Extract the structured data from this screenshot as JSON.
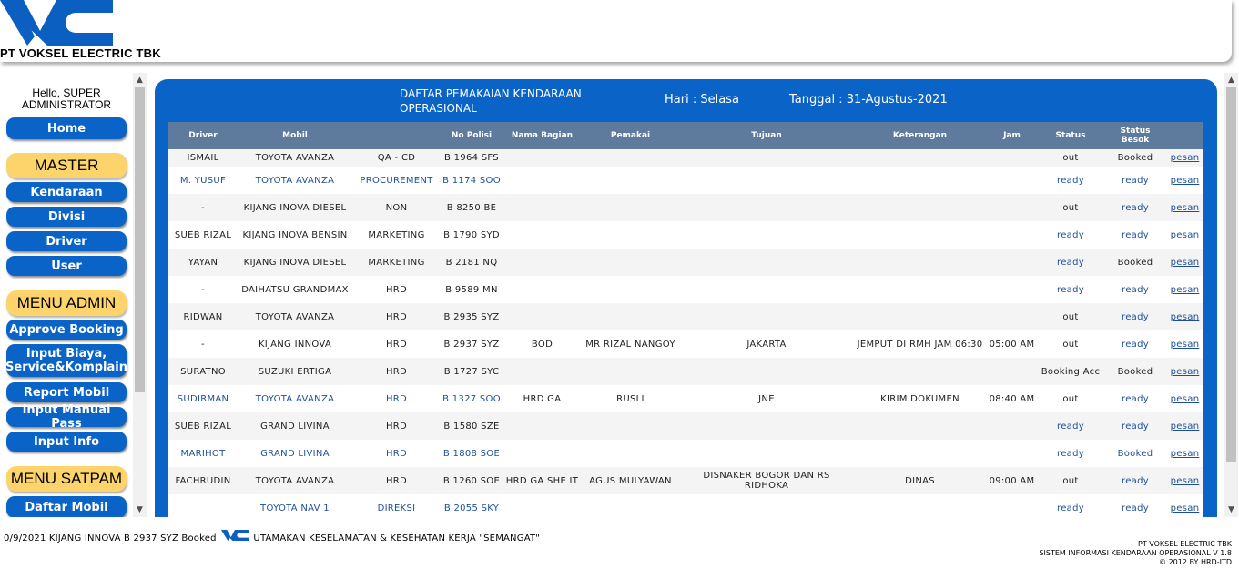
{
  "header": {
    "company": "PT VOKSEL ELECTRIC TBK",
    "logo_icon": "vc-logo-icon",
    "logo_color": "#0a5fc1"
  },
  "sidebar": {
    "greeting": "Hello, SUPER ADMINISTRATOR",
    "home": "Home",
    "master_label": "MASTER",
    "master_items": [
      "Kendaraan",
      "Divisi",
      "Driver",
      "User"
    ],
    "admin_label": "MENU ADMIN",
    "admin_items": [
      "Approve Booking",
      "Input Biaya, Service&Komplain",
      "Report Mobil",
      "Input Manual Pass",
      "Input Info"
    ],
    "satpam_label": "MENU SATPAM",
    "satpam_items": [
      "Daftar Mobil"
    ]
  },
  "panel": {
    "title": "DAFTAR PEMAKAIAN KENDARAAN OPERASIONAL",
    "day": "Hari : Selasa",
    "date": "Tanggal : 31-Agustus-2021",
    "accent_color": "#0a64c8",
    "header_color": "#5e7a9c"
  },
  "table": {
    "columns": [
      "Driver",
      "Mobil",
      "",
      "No Polisi",
      "Nama Bagian",
      "Pemakai",
      "Tujuan",
      "Keterangan",
      "Jam",
      "Status",
      "Status Besok",
      ""
    ],
    "rows": [
      {
        "driver": "ISMAIL",
        "mobil": "TOYOTA AVANZA",
        "divisi": "QA - CD",
        "nopol": "B 1964 SFS",
        "bagian": "",
        "pemakai": "",
        "tujuan": "",
        "keterangan": "",
        "jam": "",
        "status": "out",
        "besok": "Booked",
        "aksi": "pesan"
      },
      {
        "driver": "M. YUSUF",
        "mobil": "TOYOTA AVANZA",
        "divisi": "PROCUREMENT",
        "nopol": "B 1174 SOO",
        "bagian": "",
        "pemakai": "",
        "tujuan": "",
        "keterangan": "",
        "jam": "",
        "status": "ready",
        "besok": "ready",
        "aksi": "pesan"
      },
      {
        "driver": "-",
        "mobil": "KIJANG INOVA DIESEL",
        "divisi": "NON",
        "nopol": "B 8250 BE",
        "bagian": "",
        "pemakai": "",
        "tujuan": "",
        "keterangan": "",
        "jam": "",
        "status": "out",
        "besok": "ready",
        "aksi": "pesan"
      },
      {
        "driver": "SUEB RIZAL",
        "mobil": "KIJANG INOVA BENSIN",
        "divisi": "MARKETING",
        "nopol": "B 1790 SYD",
        "bagian": "",
        "pemakai": "",
        "tujuan": "",
        "keterangan": "",
        "jam": "",
        "status": "ready",
        "besok": "ready",
        "aksi": "pesan"
      },
      {
        "driver": "YAYAN",
        "mobil": "KIJANG INOVA DIESEL",
        "divisi": "MARKETING",
        "nopol": "B 2181 NQ",
        "bagian": "",
        "pemakai": "",
        "tujuan": "",
        "keterangan": "",
        "jam": "",
        "status": "ready",
        "besok": "Booked",
        "aksi": "pesan"
      },
      {
        "driver": "-",
        "mobil": "DAIHATSU GRANDMAX",
        "divisi": "HRD",
        "nopol": "B 9589 MN",
        "bagian": "",
        "pemakai": "",
        "tujuan": "",
        "keterangan": "",
        "jam": "",
        "status": "ready",
        "besok": "ready",
        "aksi": "pesan"
      },
      {
        "driver": "RIDWAN",
        "mobil": "TOYOTA AVANZA",
        "divisi": "HRD",
        "nopol": "B 2935 SYZ",
        "bagian": "",
        "pemakai": "",
        "tujuan": "",
        "keterangan": "",
        "jam": "",
        "status": "out",
        "besok": "ready",
        "aksi": "pesan"
      },
      {
        "driver": "-",
        "mobil": "KIJANG INNOVA",
        "divisi": "HRD",
        "nopol": "B 2937 SYZ",
        "bagian": "BOD",
        "pemakai": "MR RIZAL NANGOY",
        "tujuan": "JAKARTA",
        "keterangan": "JEMPUT DI RMH JAM 06:30",
        "jam": "05:00 AM",
        "status": "out",
        "besok": "ready",
        "aksi": "pesan"
      },
      {
        "driver": "SURATNO",
        "mobil": "SUZUKI ERTIGA",
        "divisi": "HRD",
        "nopol": "B 1727 SYC",
        "bagian": "",
        "pemakai": "",
        "tujuan": "",
        "keterangan": "",
        "jam": "",
        "status": "Booking Acc",
        "besok": "Booked",
        "aksi": "pesan"
      },
      {
        "driver": "SUDIRMAN",
        "mobil": "TOYOTA AVANZA",
        "divisi": "HRD",
        "nopol": "B 1327 SOO",
        "bagian": "HRD GA",
        "pemakai": "RUSLI",
        "tujuan": "JNE",
        "keterangan": "KIRIM DOKUMEN",
        "jam": "08:40 AM",
        "status": "out",
        "besok": "ready",
        "aksi": "pesan"
      },
      {
        "driver": "SUEB RIZAL",
        "mobil": "GRAND LIVINA",
        "divisi": "HRD",
        "nopol": "B 1580 SZE",
        "bagian": "",
        "pemakai": "",
        "tujuan": "",
        "keterangan": "",
        "jam": "",
        "status": "ready",
        "besok": "ready",
        "aksi": "pesan"
      },
      {
        "driver": "MARIHOT",
        "mobil": "GRAND LIVINA",
        "divisi": "HRD",
        "nopol": "B 1808 SOE",
        "bagian": "",
        "pemakai": "",
        "tujuan": "",
        "keterangan": "",
        "jam": "",
        "status": "ready",
        "besok": "Booked",
        "aksi": "pesan"
      },
      {
        "driver": "FACHRUDIN",
        "mobil": "TOYOTA AVANZA",
        "divisi": "HRD",
        "nopol": "B 1260 SOE",
        "bagian": "HRD GA SHE IT",
        "pemakai": "AGUS MULYAWAN",
        "tujuan": "DISNAKER BOGOR DAN RS RIDHOKA",
        "keterangan": "DINAS",
        "jam": "09:00 AM",
        "status": "out",
        "besok": "ready",
        "aksi": "pesan"
      },
      {
        "driver": "",
        "mobil": "TOYOTA NAV 1",
        "divisi": "DIREKSI",
        "nopol": "B 2055 SKY",
        "bagian": "",
        "pemakai": "",
        "tujuan": "",
        "keterangan": "",
        "jam": "",
        "status": "ready",
        "besok": "ready",
        "aksi": "pesan"
      }
    ]
  },
  "footer": {
    "marquee_left": "0/9/2021 KIJANG INNOVA B 2937 SYZ Booked",
    "marquee_right": "UTAMAKAN KESELAMATAN & KESEHATAN KERJA \"SEMANGAT\"",
    "credit_1": "PT VOKSEL ELECTRIC TBK",
    "credit_2": "SISTEM INFORMASI KENDARAAN OPERASIONAL V 1.8",
    "credit_3": "© 2012 BY HRD-ITD"
  }
}
